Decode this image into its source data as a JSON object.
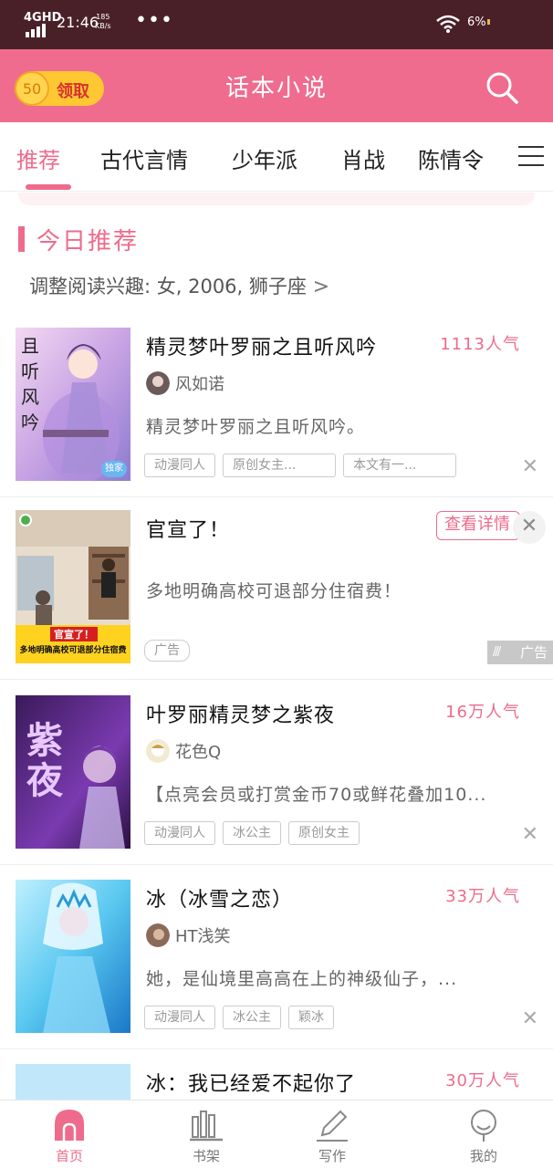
{
  "status_bar": {
    "network": "4GHD",
    "time": "21:46",
    "speed_value": "185",
    "speed_unit": "KB/s",
    "dots": "•••",
    "battery": "6%"
  },
  "header": {
    "coins": "50",
    "claim_label": "领取",
    "title": "话本小说",
    "search_icon": "search-icon"
  },
  "tabs": [
    {
      "label": "推荐",
      "active": true
    },
    {
      "label": "古代言情",
      "active": false
    },
    {
      "label": "少年派",
      "active": false
    },
    {
      "label": "肖战",
      "active": false
    },
    {
      "label": "陈情令",
      "active": false
    }
  ],
  "section": {
    "title": "今日推荐",
    "interest_text": "调整阅读兴趣: 女, 2006, 狮子座",
    "interest_chevron": ">"
  },
  "books": [
    {
      "title": "精灵梦叶罗丽之且听风吟",
      "popularity": "1113人气",
      "author": "风如诺",
      "description": "精灵梦叶罗丽之且听风吟。",
      "tags": [
        "动漫同人",
        "原创女主...",
        "本文有一..."
      ],
      "cover_text": "且听风吟",
      "cover_badge": "独家",
      "close": "✕"
    },
    {
      "title": "叶罗丽精灵梦之紫夜",
      "popularity": "16万人气",
      "author": "花色Q",
      "description": "【点亮会员或打赏金币70或鲜花叠加10...",
      "tags": [
        "动漫同人",
        "冰公主",
        "原创女主"
      ],
      "cover_text": "紫夜",
      "close": "✕"
    },
    {
      "title": "冰（冰雪之恋）",
      "popularity": "33万人气",
      "author": "HT浅笑",
      "description": "她，是仙境里高高在上的神级仙子，...",
      "tags": [
        "动漫同人",
        "冰公主",
        "颖冰"
      ],
      "close": "✕"
    },
    {
      "title": "冰：我已经爱不起你了",
      "popularity": "30万人气"
    }
  ],
  "ad": {
    "title": "官宣了！",
    "detail_button": "查看详情",
    "description": "多地明确高校可退部分住宿费！",
    "tag": "广告",
    "mark": "广告",
    "close": "✕",
    "image_banner_1": "官宣了！",
    "image_banner_2": "多地明确高校可退部分住宿费"
  },
  "bottom_nav": [
    {
      "label": "首页",
      "icon": "home-icon",
      "active": true
    },
    {
      "label": "书架",
      "icon": "bookshelf-icon",
      "active": false
    },
    {
      "label": "写作",
      "icon": "pencil-icon",
      "active": false
    },
    {
      "label": "我的",
      "icon": "profile-icon",
      "active": false
    }
  ],
  "colors": {
    "accent": "#ee6b8c",
    "header_bg": "#ef6c8e",
    "status_bar_bg": "#4a2028",
    "coin": "#ffc832"
  }
}
